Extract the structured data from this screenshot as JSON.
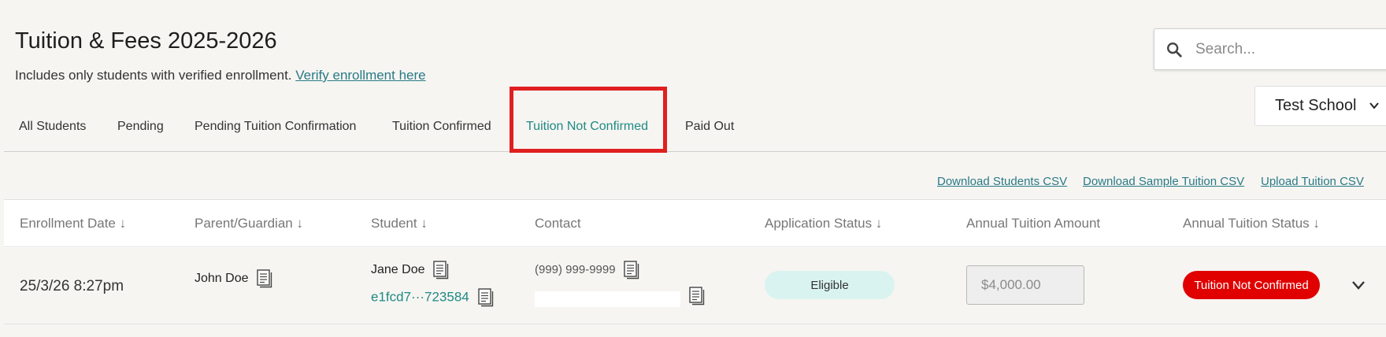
{
  "header": {
    "title": "Tuition & Fees 2025-2026",
    "subtitle_text": "Includes only students with verified enrollment.",
    "subtitle_link": "Verify enrollment here"
  },
  "search": {
    "placeholder": "Search...",
    "icon": "search-icon"
  },
  "school_select": {
    "value": "Test School"
  },
  "tabs": [
    {
      "label": "All Students"
    },
    {
      "label": "Pending"
    },
    {
      "label": "Pending Tuition Confirmation"
    },
    {
      "label": "Tuition Confirmed"
    },
    {
      "label": "Tuition Not Confirmed",
      "active": true
    },
    {
      "label": "Paid Out"
    }
  ],
  "highlight_color": "#e02020",
  "accent_color": "#1f8a84",
  "csv_links": {
    "download_students": "Download Students CSV",
    "download_sample": "Download Sample Tuition CSV",
    "upload": "Upload Tuition CSV"
  },
  "table": {
    "columns": [
      "Enrollment Date ↓",
      "Parent/Guardian ↓",
      "Student ↓",
      "Contact",
      "Application Status ↓",
      "Annual Tuition Amount",
      "Annual Tuition Status ↓"
    ],
    "rows": [
      {
        "enrollment_date": "25/3/26 8:27pm",
        "parent": "John Doe",
        "student_name": "Jane Doe",
        "student_id": "e1fcd7···723584",
        "phone": "(999) 999-9999",
        "application_status": "Eligible",
        "tuition_amount": "$4,000.00",
        "tuition_status": "Tuition Not Confirmed",
        "tuition_status_color": "#e00000"
      }
    ]
  }
}
